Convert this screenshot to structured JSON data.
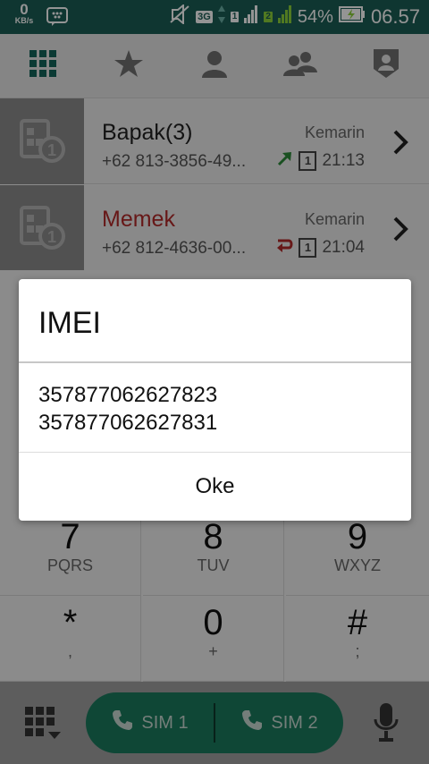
{
  "status_bar": {
    "speed_value": "0",
    "speed_unit": "KB/s",
    "network_type": "3G",
    "sim1_label": "1",
    "sim2_label": "2",
    "battery": "54%",
    "time": "06.57"
  },
  "tabs": [
    {
      "icon": "dialpad-grid-icon",
      "active": true
    },
    {
      "icon": "star-icon"
    },
    {
      "icon": "person-icon"
    },
    {
      "icon": "group-icon"
    },
    {
      "icon": "profile-shield-icon"
    }
  ],
  "call_log": [
    {
      "name": "Bapak(3)",
      "number": "+62 813-3856-49...",
      "date": "Kemarin",
      "sim": "1",
      "time": "21:13",
      "type": "outgoing",
      "type_color": "#2e8b3a"
    },
    {
      "name": "Memek",
      "number": "+62 812-4636-00...",
      "date": "Kemarin",
      "sim": "1",
      "time": "21:04",
      "type": "missed",
      "type_color": "#b22a2a"
    }
  ],
  "dialpad": {
    "keys": [
      {
        "digit": "7",
        "letters": "PQRS"
      },
      {
        "digit": "8",
        "letters": "TUV"
      },
      {
        "digit": "9",
        "letters": "WXYZ"
      },
      {
        "digit": "*",
        "letters": ","
      },
      {
        "digit": "0",
        "letters": "+"
      },
      {
        "digit": "#",
        "letters": ";"
      }
    ]
  },
  "dialog": {
    "title": "IMEI",
    "imei_1": "357877062627823",
    "imei_2": "357877062627831",
    "button_label": "Oke"
  },
  "bottom_bar": {
    "sim1_label": "SIM 1",
    "sim2_label": "SIM 2"
  },
  "colors": {
    "status_bar": "#1a5e55",
    "accent": "#1b7a5e",
    "missed": "#b22a2a",
    "outgoing": "#2e8b3a"
  }
}
